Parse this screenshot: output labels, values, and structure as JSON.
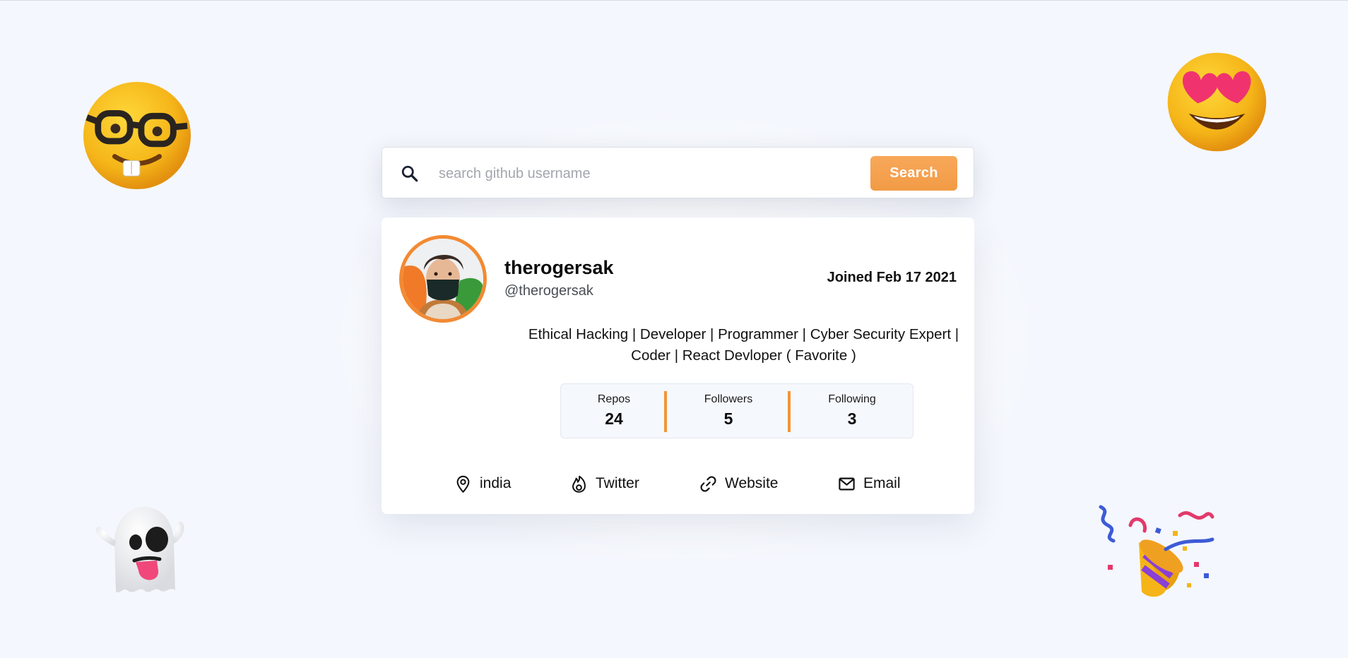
{
  "search": {
    "placeholder": "search github username",
    "value": "",
    "button_label": "Search"
  },
  "profile": {
    "name": "therogersak",
    "handle": "@therogersak",
    "joined": "Joined Feb 17 2021",
    "bio": "Ethical Hacking | Developer | Programmer | Cyber Security Expert | Coder | React Devloper ( Favorite )"
  },
  "stats": [
    {
      "label": "Repos",
      "value": "24"
    },
    {
      "label": "Followers",
      "value": "5"
    },
    {
      "label": "Following",
      "value": "3"
    }
  ],
  "links": [
    {
      "label": "india",
      "icon": "location-pin-icon"
    },
    {
      "label": "Twitter",
      "icon": "twitter-icon"
    },
    {
      "label": "Website",
      "icon": "link-icon"
    },
    {
      "label": "Email",
      "icon": "mail-icon"
    }
  ],
  "decorations": [
    "nerd-face-emoji",
    "heart-eyes-emoji",
    "ghost-emoji",
    "party-popper-emoji"
  ],
  "colors": {
    "accent": "#f29b45",
    "avatar_ring": "#f28a32",
    "background": "#f4f7fd",
    "card": "#ffffff"
  }
}
